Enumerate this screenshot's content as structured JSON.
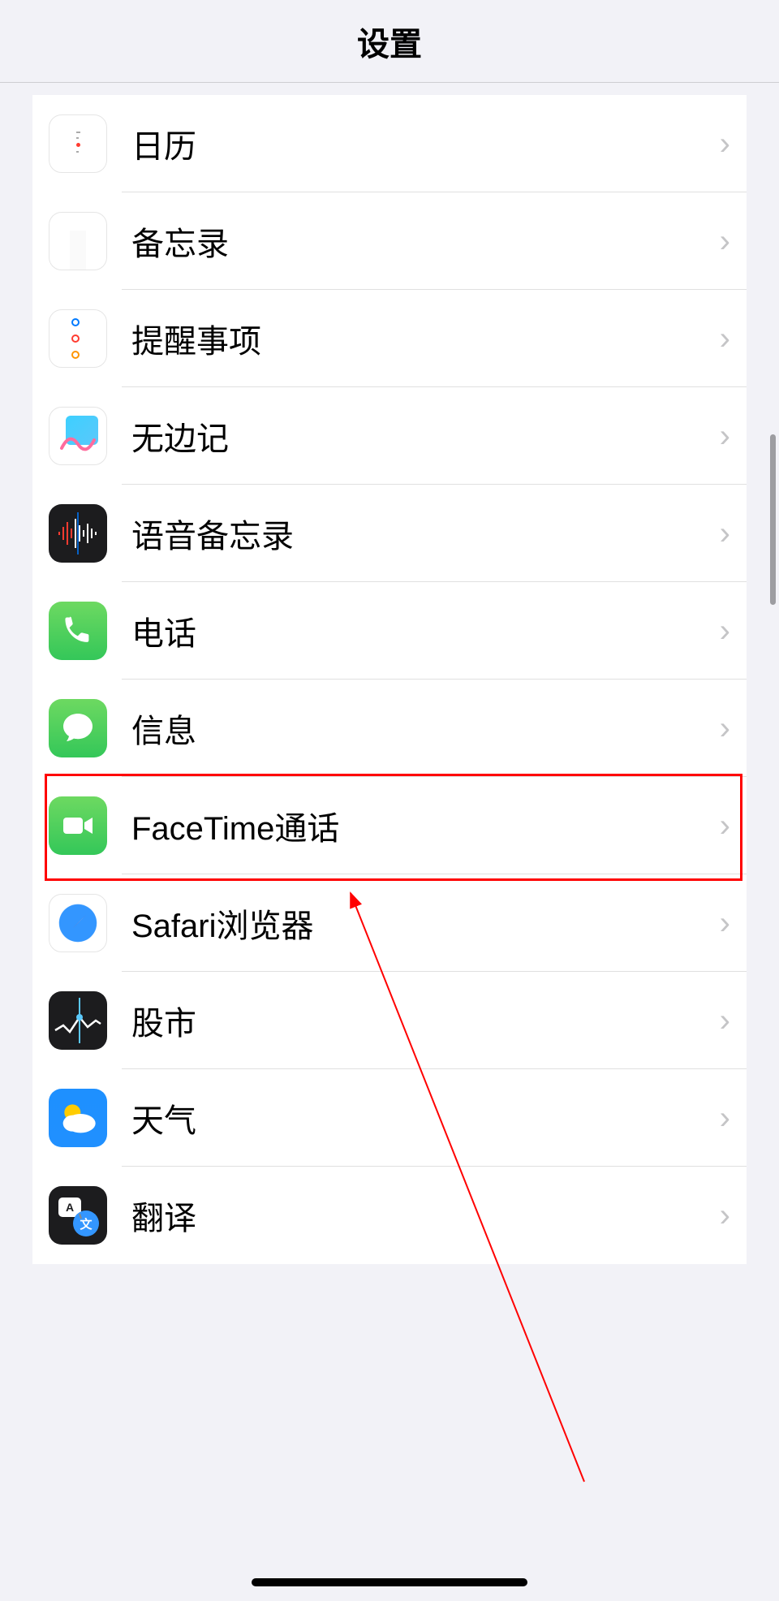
{
  "header": {
    "title": "设置"
  },
  "list": {
    "items": [
      {
        "label": "日历",
        "icon": "calendar"
      },
      {
        "label": "备忘录",
        "icon": "notes"
      },
      {
        "label": "提醒事项",
        "icon": "reminders"
      },
      {
        "label": "无边记",
        "icon": "freeform"
      },
      {
        "label": "语音备忘录",
        "icon": "voicememo"
      },
      {
        "label": "电话",
        "icon": "phone"
      },
      {
        "label": "信息",
        "icon": "messages"
      },
      {
        "label": "FaceTime通话",
        "icon": "facetime"
      },
      {
        "label": "Safari浏览器",
        "icon": "safari"
      },
      {
        "label": "股市",
        "icon": "stocks"
      },
      {
        "label": "天气",
        "icon": "weather"
      },
      {
        "label": "翻译",
        "icon": "translate"
      }
    ]
  },
  "annotation": {
    "highlighted_index": 5,
    "highlight_color": "#ff0000"
  }
}
